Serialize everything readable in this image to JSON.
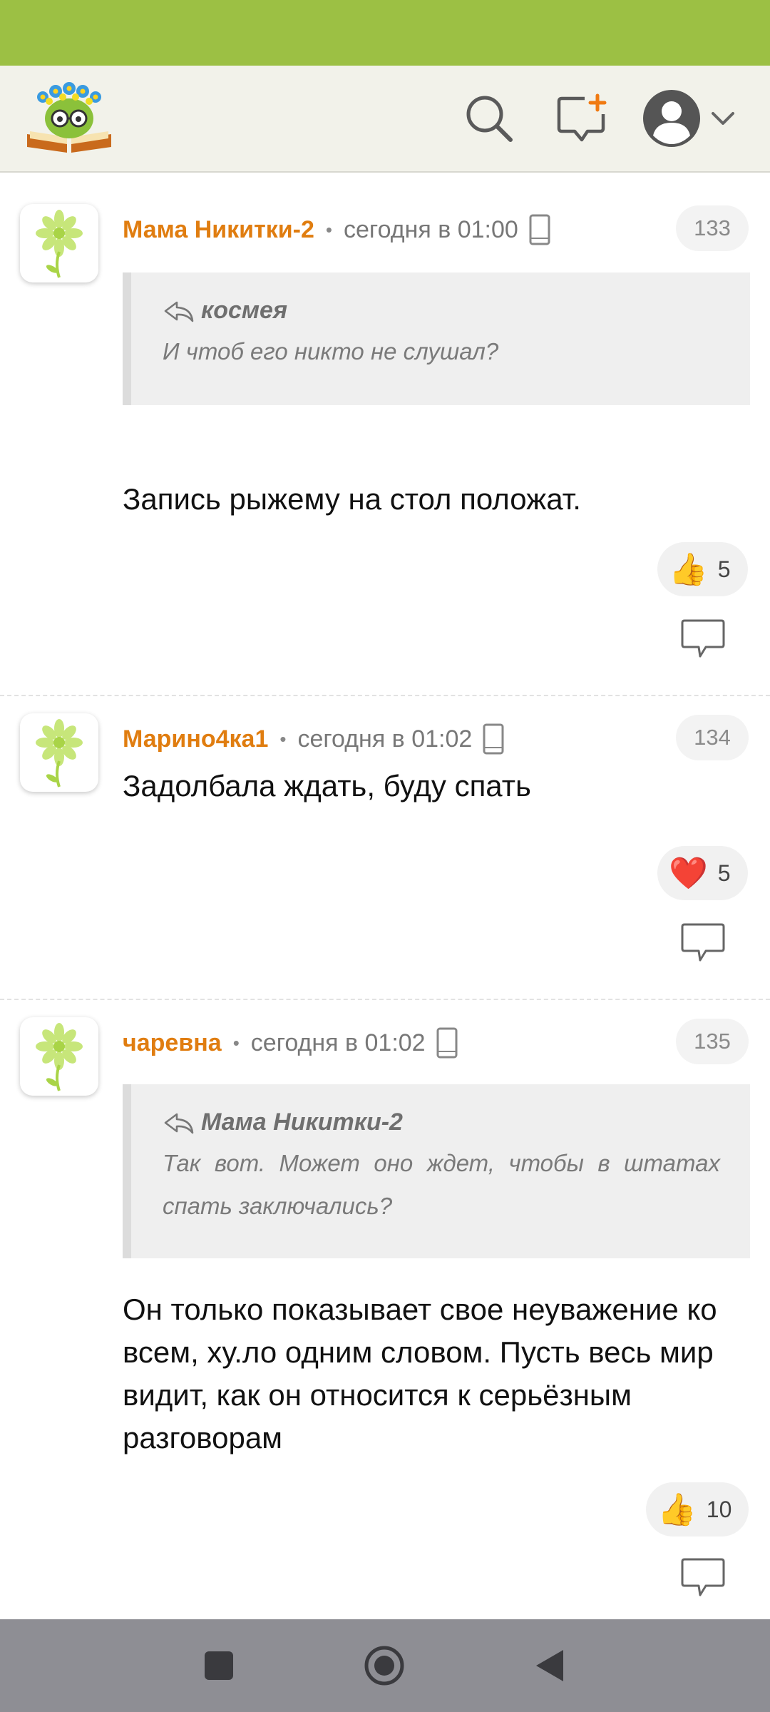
{
  "header": {
    "logo_name": "site-logo",
    "icons": [
      "search-icon",
      "new-post-icon",
      "profile-icon",
      "chevron-down-icon"
    ]
  },
  "comments": [
    {
      "author": "Мама Никитки-2",
      "time": "сегодня в 01:00",
      "number": "133",
      "quote_author": "космея",
      "quote_text": "И чтоб его никто не слушал?",
      "text": "Запись рыжему на стол положат.",
      "reaction_icon": "thumbs-up-icon",
      "reaction_emoji": "👍",
      "reaction_count": "5"
    },
    {
      "author": "Марино4ка1",
      "time": "сегодня в 01:02",
      "number": "134",
      "text": "Задолбала ждать, буду спать",
      "reaction_icon": "heart-icon",
      "reaction_emoji": "❤️",
      "reaction_count": "5"
    },
    {
      "author": "чаревна",
      "time": "сегодня в 01:02",
      "number": "135",
      "quote_author": "Мама Никитки-2",
      "quote_text": "Так вот. Может оно ждет, чтобы в штатах спать заключались?",
      "text": "Он только показывает свое неуважение ко всем, ху.ло одним словом. Пусть весь мир видит, как он относится к серьёзным разговорам",
      "reaction_icon": "thumbs-up-icon",
      "reaction_emoji": "👍",
      "reaction_count": "10"
    }
  ],
  "navbar": {
    "icons": [
      "recents-icon",
      "home-icon",
      "back-icon"
    ]
  },
  "colors": {
    "status_bar": "#9cc044",
    "header_bg": "#f2f2ea",
    "author": "#e07d10",
    "navbar": "#8e8e94"
  }
}
